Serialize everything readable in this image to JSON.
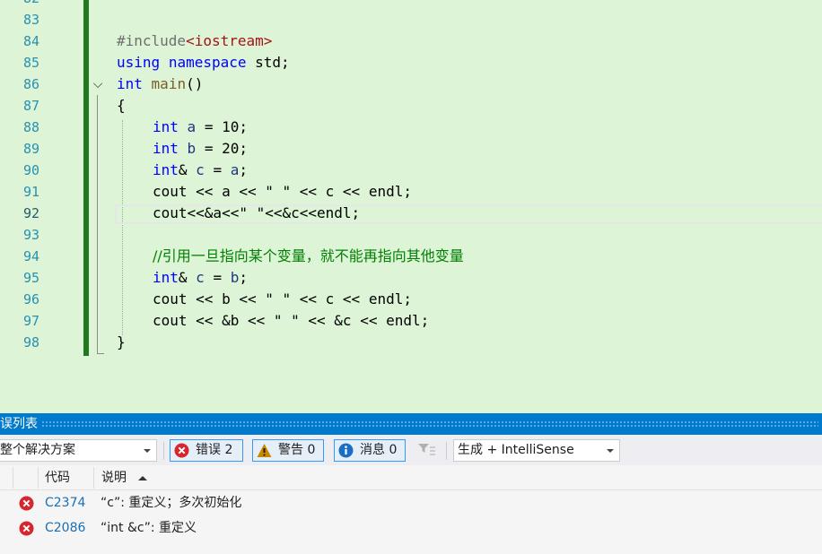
{
  "editor": {
    "line_numbers": [
      "82",
      "83",
      "84",
      "85",
      "86",
      "87",
      "88",
      "89",
      "90",
      "91",
      "92",
      "93",
      "94",
      "95",
      "96",
      "97",
      "98"
    ],
    "current_line": "92",
    "lines": {
      "l84": {
        "pre": "#include",
        "inc": "<iostream>"
      },
      "l85": {
        "kw1": "using",
        "kw2": "namespace",
        "rest": " std;"
      },
      "l86": {
        "kw": "int",
        "fn": "main",
        "rest": "()"
      },
      "l87": {
        "text": "{"
      },
      "l88": {
        "kw": "int",
        "var": "a",
        "rest": " = 10;"
      },
      "l89": {
        "kw": "int",
        "var": "b",
        "rest": " = 20;"
      },
      "l90": {
        "kw": "int",
        "amp": "& ",
        "var": "c",
        "mid": " = ",
        "var2": "a",
        "end": ";"
      },
      "l91": {
        "text": "cout << a << \" \" << c << endl;"
      },
      "l92": {
        "text": "cout<<&a<<\" \"<<&c<<endl;"
      },
      "l94": {
        "comment": "//引用一旦指向某个变量，就不能再指向其他变量"
      },
      "l95": {
        "kw": "int",
        "amp": "& ",
        "var": "c",
        "mid": " = ",
        "var2": "b",
        "end": ";"
      },
      "l96": {
        "text": "cout << b << \" \" << c << endl;"
      },
      "l97": {
        "text": "cout << &b << \" \" << &c << endl;"
      },
      "l98": {
        "text": "}"
      }
    }
  },
  "error_list": {
    "title": "误列表",
    "scope": "整个解决方案",
    "errors_label": "错误 2",
    "warnings_label": "警告 0",
    "messages_label": "消息 0",
    "build_filter": "生成 + IntelliSense",
    "columns": {
      "code": "代码",
      "description": "说明"
    },
    "rows": [
      {
        "code": "C2374",
        "description": "“c”: 重定义；多次初始化"
      },
      {
        "code": "C2086",
        "description": "“int &c”: 重定义"
      }
    ]
  },
  "colors": {
    "accent": "#007acc",
    "editor_bg": "#ddf4d7",
    "change_bar": "#1f7a1f",
    "error": "#d8262e"
  }
}
